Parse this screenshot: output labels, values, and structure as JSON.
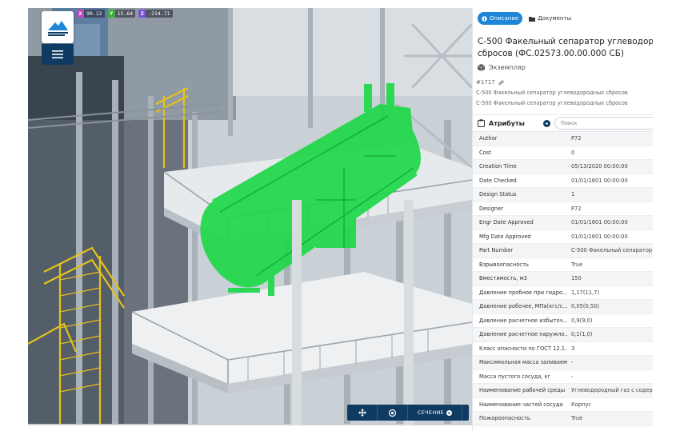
{
  "viewport": {
    "coords": [
      {
        "axis": "X",
        "value": "90.12",
        "color": "#c246c2"
      },
      {
        "axis": "Y",
        "value": "15.64",
        "color": "#3eae3e"
      },
      {
        "axis": "Z",
        "value": "-214.71",
        "color": "#7a52d6"
      }
    ],
    "toolbar": {
      "move_icon": "move-icon",
      "target_icon": "target-icon",
      "section_label": "СЕЧЕНИЕ"
    },
    "highlight_color": "#1fd84a"
  },
  "panel": {
    "tabs": [
      {
        "label": "Описание",
        "active": true,
        "icon": "info-icon"
      },
      {
        "label": "Документы",
        "active": false,
        "icon": "folder-icon"
      }
    ],
    "title_line1": "С-500 Факельный сепаратор углеводород",
    "title_line2": "сбросов (ФС.02573.00.00.000 СБ)",
    "instance_label": "Экземпляр",
    "id": "#1717",
    "description1": "С-500 Факельный сепаратор углеводородных сбросов",
    "description2": "С-500 Факельный сепаратор углеводородных сбросов",
    "attributes_label": "Атрибуты",
    "search_placeholder": "Поиск",
    "attributes": [
      {
        "key": "Author",
        "value": "P72"
      },
      {
        "key": "Cost",
        "value": "0"
      },
      {
        "key": "Creation Time",
        "value": "05/13/2020 00:00:00"
      },
      {
        "key": "Date Checked",
        "value": "01/01/1601 00:00:00"
      },
      {
        "key": "Design Status",
        "value": "1"
      },
      {
        "key": "Designer",
        "value": "P72"
      },
      {
        "key": "Engr Date Approved",
        "value": "01/01/1601 00:00:00"
      },
      {
        "key": "Mfg Date Approved",
        "value": "01/01/1601 00:00:00"
      },
      {
        "key": "Part Number",
        "value": "С-500 Факельный сепаратор"
      },
      {
        "key": "Взрывоопасность",
        "value": "True"
      },
      {
        "key": "Вместимость, м3",
        "value": "150"
      },
      {
        "key": "Давление пробное при гидро...",
        "value": "1,17(11,7)"
      },
      {
        "key": "Давление рабочее, МПа(кгс/с...",
        "value": "0,05(0,50)"
      },
      {
        "key": "Давление расчетное избыточ...",
        "value": "0,9(9,0)"
      },
      {
        "key": "Давление расчетное наружно...",
        "value": "0,1(1,0)"
      },
      {
        "key": "Класс опасности по ГОСТ 12.1...",
        "value": "3"
      },
      {
        "key": "Максимальная масса заливаем...",
        "value": "-"
      },
      {
        "key": "Масса пустого сосуда, кг",
        "value": "-"
      },
      {
        "key": "Наименование рабочей среды",
        "value": "Углеводородный газ с содер"
      },
      {
        "key": "Наименование частей сосуда",
        "value": "Корпус"
      },
      {
        "key": "Пожароопасность",
        "value": "True"
      }
    ]
  }
}
